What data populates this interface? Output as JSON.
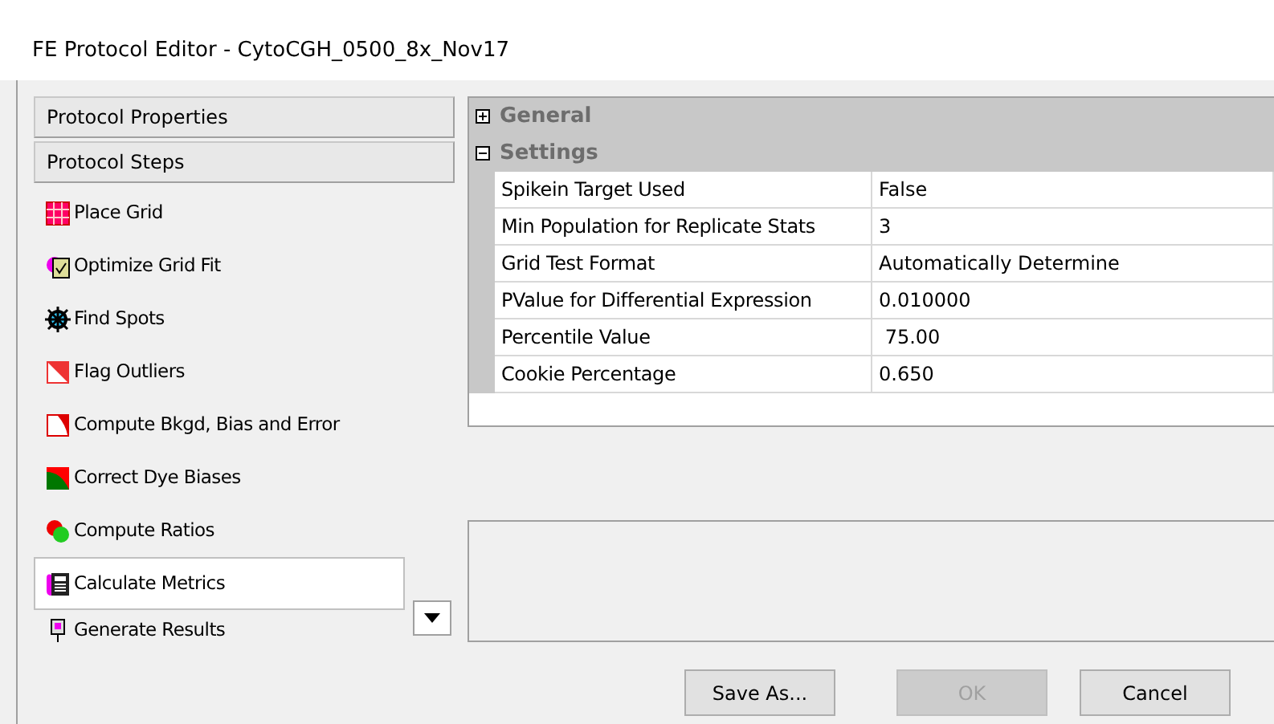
{
  "window": {
    "title": "FE Protocol Editor - CytoCGH_0500_8x_Nov17"
  },
  "sidebar": {
    "headers": [
      "Protocol Properties",
      "Protocol Steps"
    ],
    "steps": [
      {
        "label": "Place Grid",
        "kind": "grid",
        "selected": false
      },
      {
        "label": "Optimize Grid Fit",
        "kind": "optimize",
        "selected": false
      },
      {
        "label": "Find Spots",
        "kind": "spots",
        "selected": false
      },
      {
        "label": "Flag Outliers",
        "kind": "outliers",
        "selected": false
      },
      {
        "label": "Compute Bkgd, Bias and Error",
        "kind": "bkgd",
        "selected": false
      },
      {
        "label": "Correct Dye Biases",
        "kind": "dye",
        "selected": false
      },
      {
        "label": "Compute Ratios",
        "kind": "ratios",
        "selected": false
      },
      {
        "label": "Calculate Metrics",
        "kind": "metrics",
        "selected": true
      },
      {
        "label": "Generate Results",
        "kind": "results",
        "selected": false
      }
    ]
  },
  "property_grid": {
    "groups": [
      {
        "name": "General",
        "expanded": false
      },
      {
        "name": "Settings",
        "expanded": true,
        "rows": [
          {
            "name": "Spikein Target Used",
            "value": "False"
          },
          {
            "name": "Min Population for Replicate Stats",
            "value": "3"
          },
          {
            "name": "Grid Test Format",
            "value": "Automatically Determine"
          },
          {
            "name": "PValue for Differential Expression",
            "value": "0.010000"
          },
          {
            "name": "Percentile Value",
            "value": " 75.00"
          },
          {
            "name": "Cookie Percentage",
            "value": "0.650"
          }
        ]
      }
    ]
  },
  "buttons": [
    {
      "label": "Save As...",
      "disabled": false
    },
    {
      "label": "OK",
      "disabled": true
    },
    {
      "label": "Cancel",
      "disabled": false
    }
  ]
}
